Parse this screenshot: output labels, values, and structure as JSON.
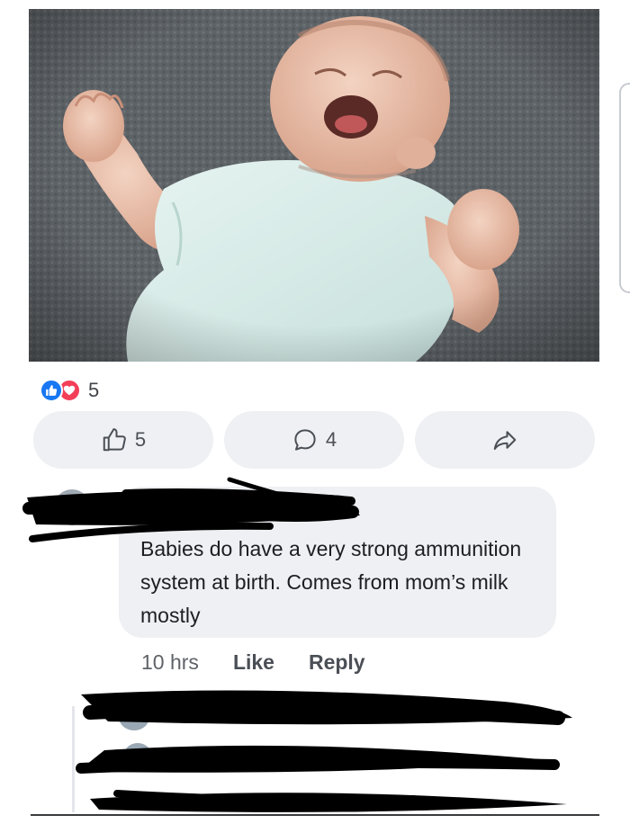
{
  "post": {
    "reaction_count": "5",
    "like_count": "5",
    "comment_count": "4"
  },
  "comment": {
    "text": "Babies do have a very strong ammunition system at birth.  Comes from mom’s milk mostly",
    "time": "10 hrs",
    "like_label": "Like",
    "reply_label": "Reply"
  },
  "colors": {
    "like_blue": "#1877f2",
    "love_red": "#f33e58",
    "button_bg": "#eef0f3",
    "redaction": "#000000"
  },
  "icons": [
    "thumbs-up-icon",
    "heart-icon",
    "comment-icon",
    "share-icon"
  ]
}
